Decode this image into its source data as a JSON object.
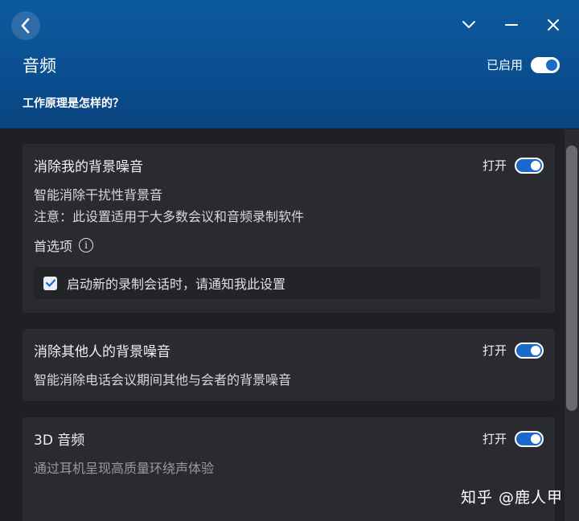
{
  "header": {
    "title": "音频",
    "enabled_label": "已启用",
    "how_link": "工作原理是怎样的？"
  },
  "cards": [
    {
      "title": "消除我的背景噪音",
      "toggle_label": "打开",
      "desc1": "智能消除干扰性背景音",
      "desc2": "注意：此设置适用于大多数会议和音频录制软件",
      "prefs_label": "首选项",
      "notify_label": "启动新的录制会话时，请通知我此设置"
    },
    {
      "title": "消除其他人的背景噪音",
      "toggle_label": "打开",
      "desc1": "智能消除电话会议期间其他与会者的背景噪音"
    },
    {
      "title": "3D 音频",
      "toggle_label": "打开",
      "desc1": "通过耳机呈现高质量环绕声体验"
    }
  ],
  "watermark": "知乎 @鹿人甲",
  "colors": {
    "accent": "#1b6ac9",
    "header_bg": "#0a4f91",
    "card_bg": "#2a2b30",
    "page_bg": "#1f2024"
  },
  "icons": {
    "back": "chevron-left-icon",
    "collapse": "chevron-down-icon",
    "minimize": "minimize-icon",
    "close": "close-icon",
    "info": "info-icon",
    "check": "checkmark-icon"
  }
}
